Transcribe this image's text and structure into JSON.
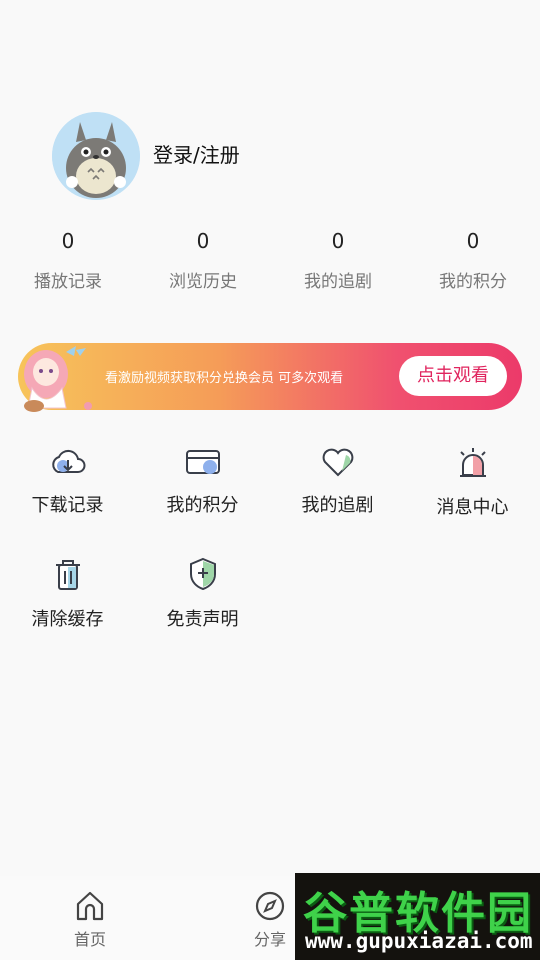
{
  "profile": {
    "login_label": "登录/注册"
  },
  "stats": [
    {
      "value": "0",
      "label": "播放记录"
    },
    {
      "value": "0",
      "label": "浏览历史"
    },
    {
      "value": "0",
      "label": "我的追剧"
    },
    {
      "value": "0",
      "label": "我的积分"
    }
  ],
  "banner": {
    "text": "看激励视频获取积分兑换会员  可多次观看",
    "button": "点击观看"
  },
  "grid": [
    {
      "label": "下载记录",
      "icon": "cloud-download-icon"
    },
    {
      "label": "我的积分",
      "icon": "card-icon"
    },
    {
      "label": "我的追剧",
      "icon": "heart-icon"
    },
    {
      "label": "消息中心",
      "icon": "alarm-icon"
    },
    {
      "label": "清除缓存",
      "icon": "trash-icon"
    },
    {
      "label": "免责声明",
      "icon": "shield-plus-icon"
    }
  ],
  "tabbar": {
    "home": "首页",
    "share": "分享"
  },
  "watermark": {
    "title": "谷普软件园",
    "url": "www.gupuxiazai.com"
  }
}
